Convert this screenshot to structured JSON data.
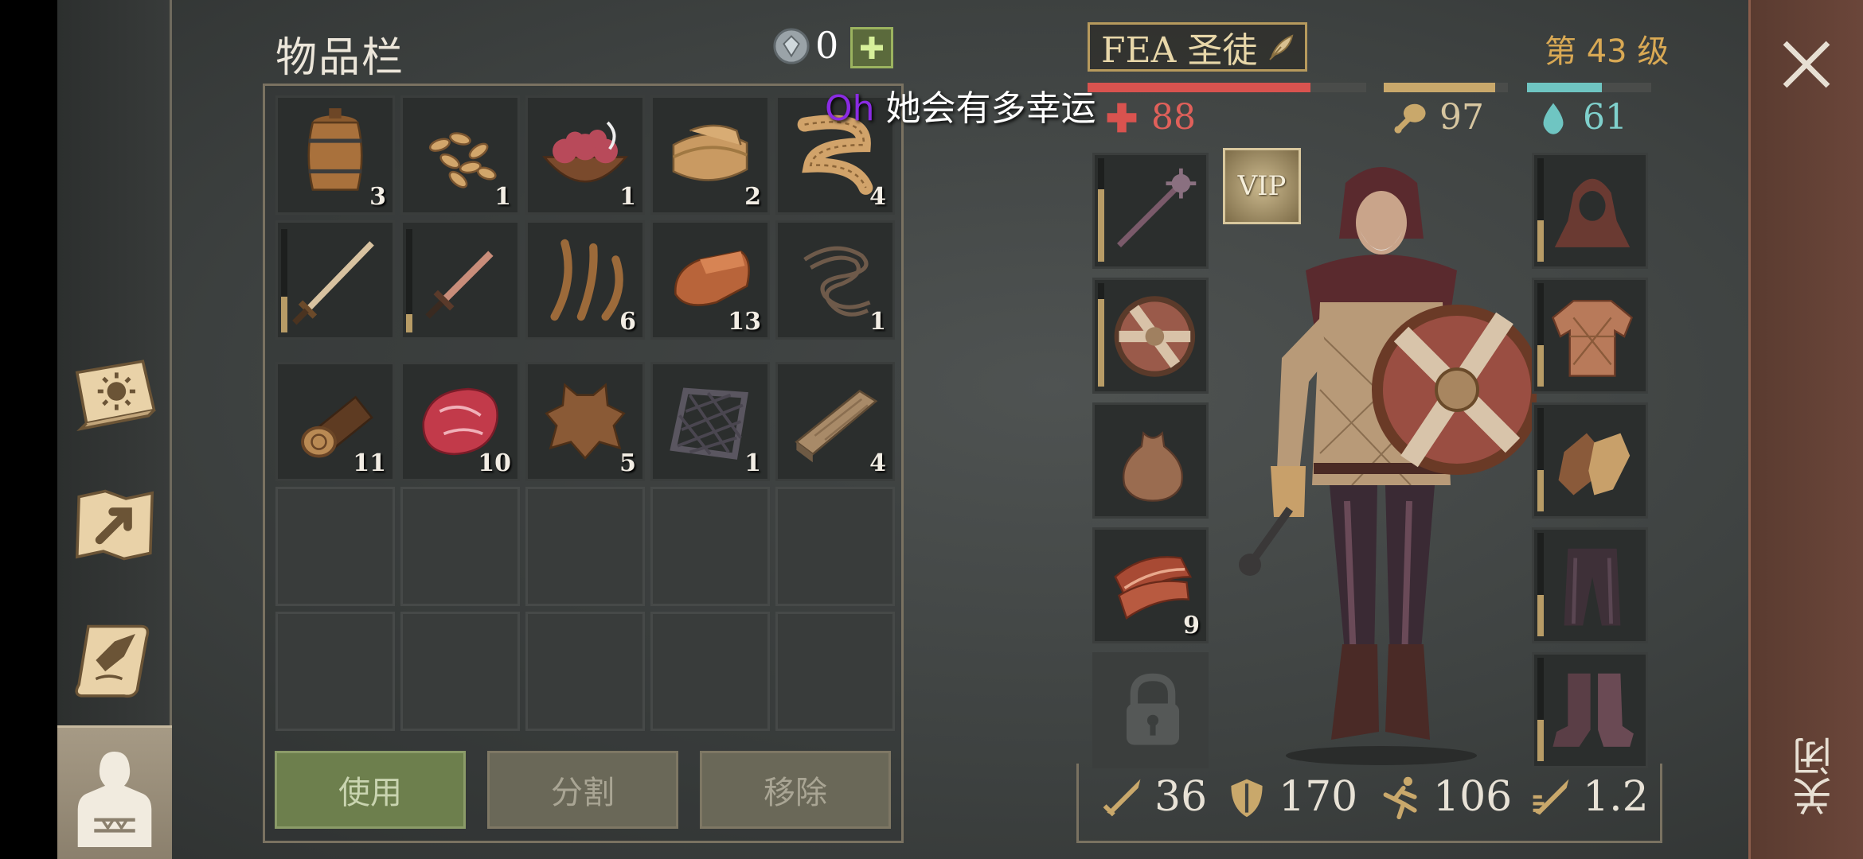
{
  "inventory": {
    "title": "物品栏",
    "gem_count": "0",
    "rows": [
      [
        {
          "name": "barrel",
          "qty": "3"
        },
        {
          "name": "seeds",
          "qty": "1"
        },
        {
          "name": "guts-bowl",
          "qty": "1"
        },
        {
          "name": "cloth",
          "qty": "2"
        },
        {
          "name": "rope-fiber",
          "qty": "4"
        }
      ],
      [
        {
          "name": "long-sword",
          "qty": ""
        },
        {
          "name": "dagger",
          "qty": ""
        },
        {
          "name": "plant-fiber",
          "qty": "6"
        },
        {
          "name": "copper-ingot",
          "qty": "13"
        },
        {
          "name": "leather-straps",
          "qty": "1"
        }
      ],
      [
        {
          "name": "log",
          "qty": "11"
        },
        {
          "name": "raw-meat",
          "qty": "10"
        },
        {
          "name": "animal-hide",
          "qty": "5"
        },
        {
          "name": "iron-grate",
          "qty": "1"
        },
        {
          "name": "plank",
          "qty": "4"
        }
      ]
    ],
    "durability": {
      "long_sword": 0.35,
      "dagger": 0.18
    },
    "buttons": {
      "use": "使用",
      "split": "分割",
      "remove": "移除"
    }
  },
  "subtitle": {
    "highlight": "Oh",
    "rest": " 她会有多幸运"
  },
  "character": {
    "name": "FEA 圣徒",
    "level": "第 43 级",
    "health": "88",
    "food": "97",
    "water": "61",
    "health_fill": 0.8,
    "food_fill": 0.9,
    "water_fill": 0.6,
    "vip": "VIP",
    "left_slots": [
      {
        "name": "mace",
        "qty": ""
      },
      {
        "name": "round-shield",
        "qty": ""
      },
      {
        "name": "pouch",
        "qty": ""
      },
      {
        "name": "bacon",
        "qty": "9"
      },
      {
        "name": "locked",
        "qty": ""
      }
    ],
    "stats": {
      "attack": "36",
      "armor": "170",
      "speed": "106",
      "attack_speed": "1.2"
    }
  },
  "close": {
    "label": "关闭"
  },
  "colors": {
    "health": "#d9534f",
    "food": "#c9a86b",
    "water": "#6fc5c2",
    "accent_gold": "#d9a954"
  }
}
